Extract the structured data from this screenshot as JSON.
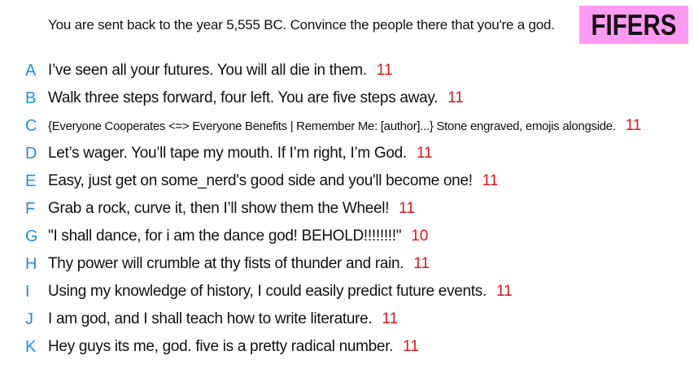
{
  "prompt": "You are sent back to the year 5,555 BC. Convince the people there that you're a god.",
  "logo": "FIFERS",
  "colors": {
    "letter": "#1f8fe6",
    "score": "#e0161c",
    "logo_bg": "#ff9af2"
  },
  "answers": [
    {
      "letter": "A",
      "text": "I’ve seen all your futures. You will all die in them.",
      "score": "11"
    },
    {
      "letter": "B",
      "text": "Walk three steps forward, four left. You are five steps away.",
      "score": "11"
    },
    {
      "letter": "C",
      "text": "{Everyone Cooperates <=> Everyone Benefits | Remember Me: [author]...} Stone engraved, emojis alongside.",
      "score": "11"
    },
    {
      "letter": "D",
      "text": "Let’s wager. You’ll tape my mouth. If I’m right, I’m God.",
      "score": "11"
    },
    {
      "letter": "E",
      "text": "Easy, just get on some_nerd's good side and you'll become one!",
      "score": "11"
    },
    {
      "letter": "F",
      "text": "Grab a rock, curve it, then I’ll show them the Wheel!",
      "score": "11"
    },
    {
      "letter": "G",
      "text": "\"I shall dance, for i am the dance god! BEHOLD!!!!!!!!\"",
      "score": "10"
    },
    {
      "letter": "H",
      "text": "Thy power will crumble at thy fists of thunder and rain.",
      "score": "11"
    },
    {
      "letter": "I",
      "text": "Using my knowledge of history, I could easily predict future events.",
      "score": "11"
    },
    {
      "letter": "J",
      "text": "I am god, and I shall teach how to write literature.",
      "score": "11"
    },
    {
      "letter": "K",
      "text": "Hey guys its me, god. five is a pretty radical number.",
      "score": "11"
    }
  ]
}
